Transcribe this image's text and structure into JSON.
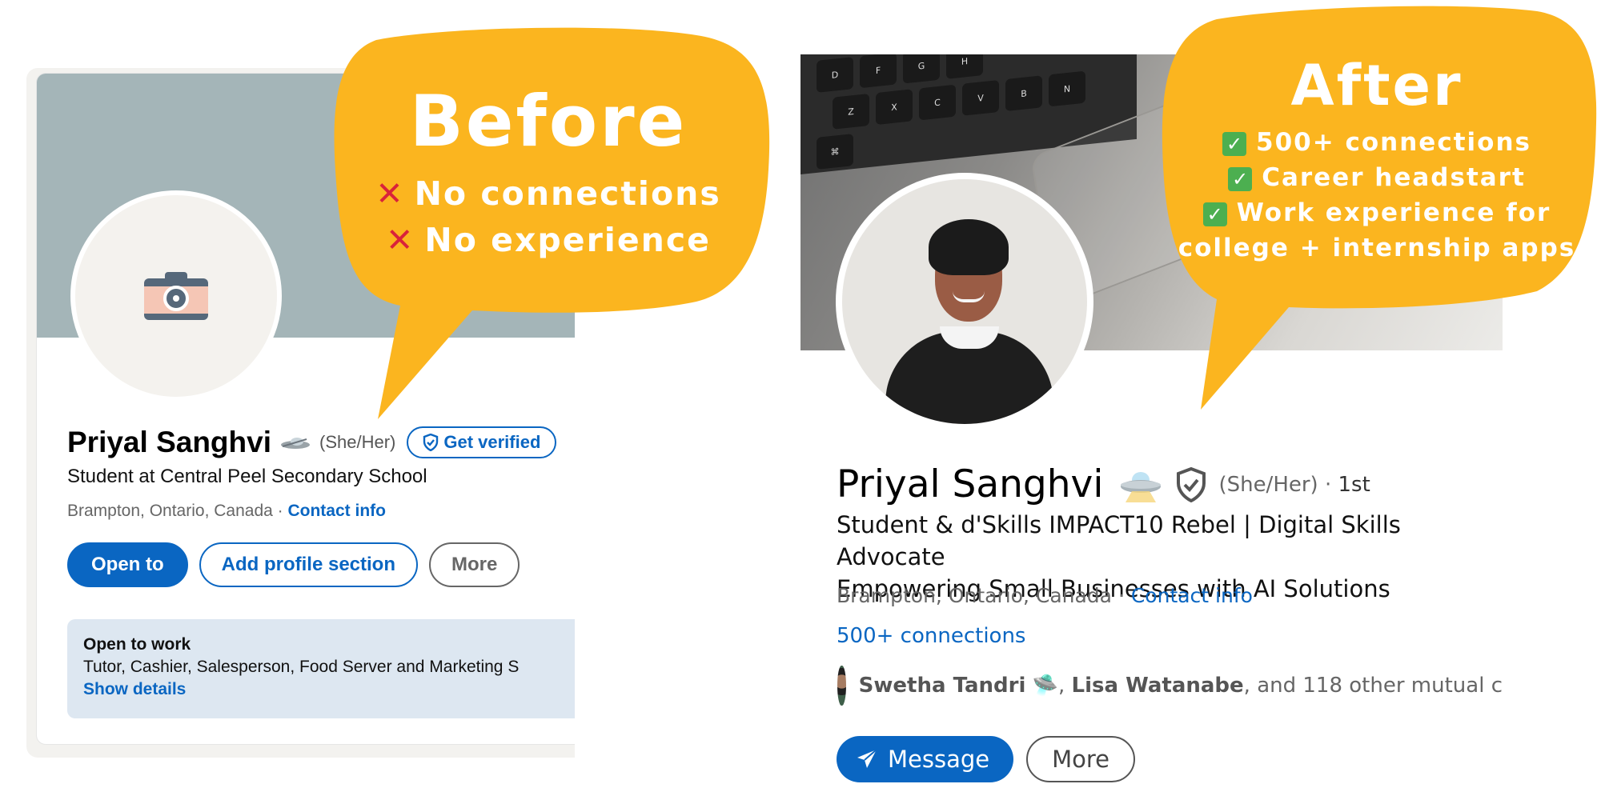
{
  "before": {
    "bubble": {
      "title": "Before",
      "points": [
        "No connections",
        "No experience"
      ]
    },
    "profile": {
      "name": "Priyal Sanghvi",
      "pronouns": "(She/Her)",
      "verify_label": "Get verified",
      "headline": "Student at Central Peel Secondary School",
      "location": "Brampton, Ontario, Canada · ",
      "contact_label": "Contact info",
      "actions": {
        "open_to": "Open to",
        "add_section": "Add profile section",
        "more": "More"
      },
      "open_to_work": {
        "title": "Open to work",
        "roles": "Tutor, Cashier, Salesperson, Food Server and Marketing S",
        "show_details": "Show details"
      }
    }
  },
  "after": {
    "bubble": {
      "title": "After",
      "points": [
        "500+ connections",
        "Career headstart",
        "Work experience for",
        "college + internship apps"
      ]
    },
    "profile": {
      "name": "Priyal Sanghvi",
      "pronouns": "(She/Her) · ",
      "degree": "1st",
      "headline_line1": "Student & d'Skills IMPACT10 Rebel | Digital Skills Advocate",
      "headline_line2": "Empowering Small Businesses with AI Solutions",
      "location": "Brampton, Ontario, Canada · ",
      "contact_label": "Contact info",
      "connections": "500+ connections",
      "mutual": {
        "name1": "Swetha Tandri",
        "sep": ", ",
        "name2": "Lisa Watanabe",
        "rest": ", and 118 other mutual c"
      },
      "actions": {
        "message": "Message",
        "more": "More"
      }
    }
  },
  "colors": {
    "bubble": "#fbb51f",
    "linkedin_blue": "#0a66c2",
    "x_mark": "#d9233a",
    "check": "#4caf50"
  },
  "icons": [
    "camera-icon",
    "ufo-icon",
    "shield-check-icon",
    "verified-shield-icon",
    "send-icon",
    "x-mark-icon",
    "check-mark-icon"
  ]
}
